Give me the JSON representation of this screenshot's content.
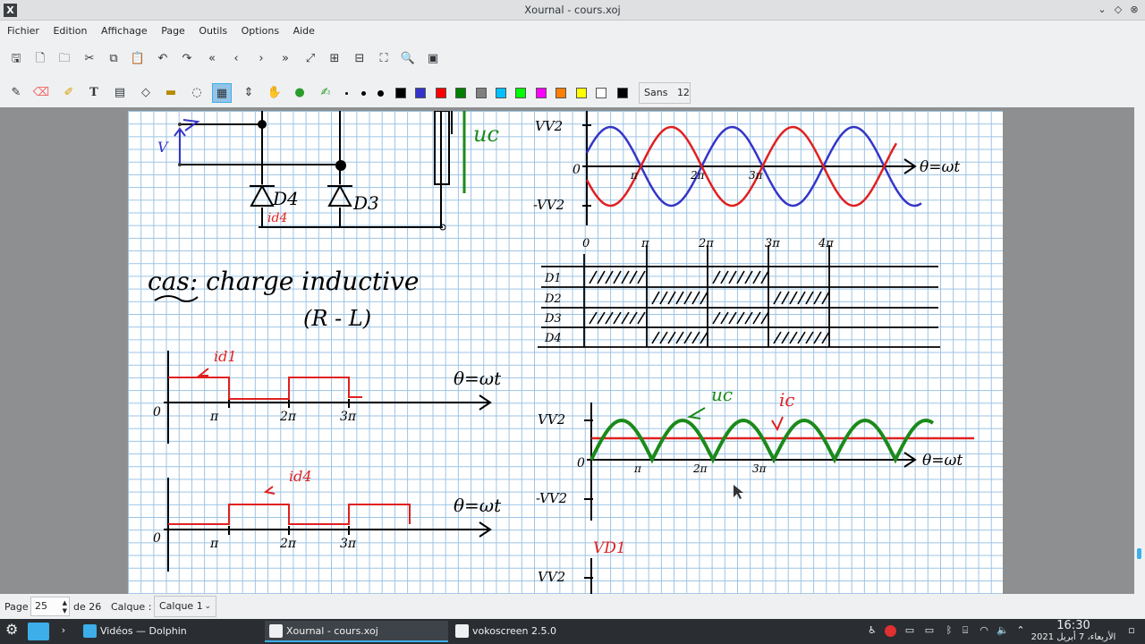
{
  "window": {
    "title": "Xournal - cours.xoj"
  },
  "menu": [
    "Fichier",
    "Edition",
    "Affichage",
    "Page",
    "Outils",
    "Options",
    "Aide"
  ],
  "toolbar": {
    "file_icons": [
      "save-icon",
      "new-page-icon",
      "open-folder-icon",
      "cut-icon",
      "copy-icon",
      "paste-icon",
      "undo-icon",
      "redo-icon",
      "first-page-icon",
      "previous-page-icon",
      "next-page-icon",
      "last-page-icon",
      "zoom-fit-icon",
      "zoom-in-icon",
      "zoom-out-icon",
      "fullscreen-icon",
      "find-icon",
      "screen-icon"
    ],
    "tool_icons": [
      "pen-icon",
      "eraser-icon",
      "highlighter-icon",
      "text-icon",
      "image-icon",
      "shape-icon",
      "ruler-icon",
      "lasso-icon",
      "select-rect-icon",
      "vertical-space-icon",
      "hand-icon",
      "default-tool-icon",
      "shape-recognizer-icon"
    ],
    "colors": [
      "#000000",
      "#3333cc",
      "#ff0000",
      "#008000",
      "#808080",
      "#00c0ff",
      "#00ff00",
      "#ff00ff",
      "#ff8000",
      "#ffff00",
      "#ffffff",
      "#000000"
    ],
    "font_name": "Sans",
    "font_size": "12"
  },
  "status": {
    "page_label": "Page",
    "page_value": "25",
    "page_of": "de 26",
    "layer_label": "Calque :",
    "layer_value": "Calque 1"
  },
  "notes": {
    "uc_top": "uc",
    "vv2": "VV2",
    "zero": "0",
    "minus_vv2": "-VV2",
    "theta_wt": "θ=ωt",
    "pi": "π",
    "two_pi": "2π",
    "three_pi": "3π",
    "four_pi": "4π",
    "d1": "D1",
    "d2": "D2",
    "d3": "D3",
    "d4": "D4",
    "v_label": "V",
    "id4_small": "id4",
    "cas_text": "cas: charge inductive",
    "rl_text": "(R - L)",
    "id1": "id1",
    "id4": "id4",
    "uc": "uc",
    "ic": "ic",
    "vd1": "VD1"
  },
  "taskbar": {
    "tasks": [
      {
        "label": "Vidéos — Dolphin",
        "color": "#3daee9"
      },
      {
        "label": "Xournal - cours.xoj",
        "color": "#ffffff"
      },
      {
        "label": "vokoscreen 2.5.0",
        "color": "#ffffff"
      }
    ],
    "time": "16:30",
    "date": "الأربعاء، 7 أبريل 2021"
  }
}
